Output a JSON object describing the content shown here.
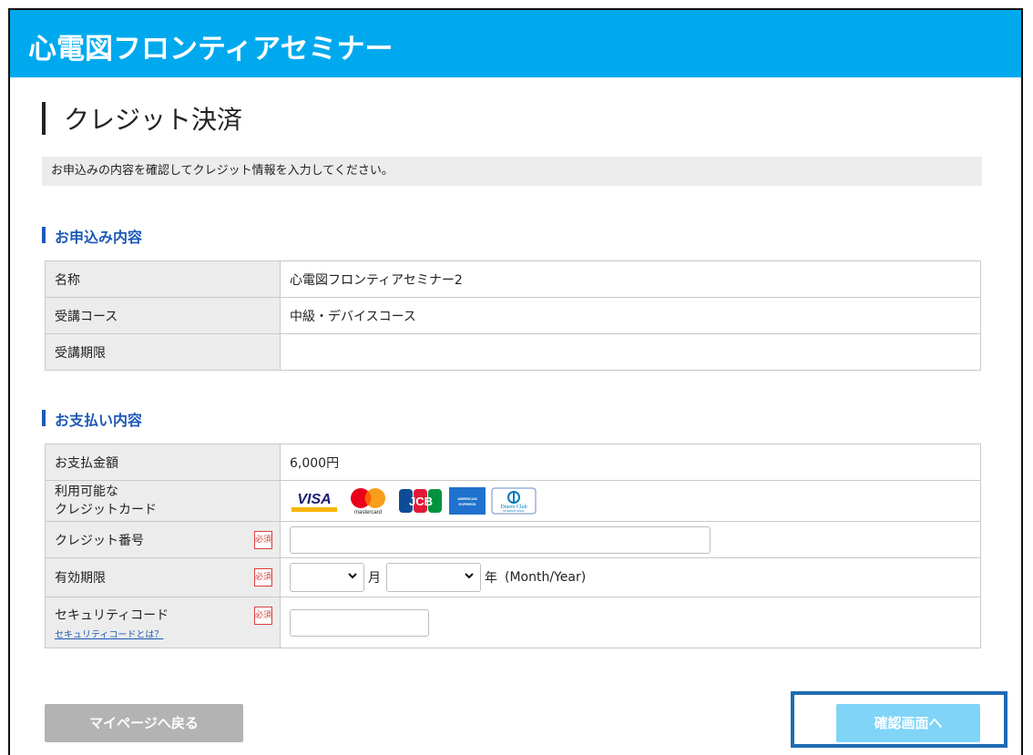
{
  "header": {
    "site_title": "心電図フロンティアセミナー"
  },
  "page": {
    "title": "クレジット決済",
    "instruction": "お申込みの内容を確認してクレジット情報を入力してください。"
  },
  "application": {
    "heading": "お申込み内容",
    "rows": [
      {
        "label": "名称",
        "value": "心電図フロンティアセミナー2"
      },
      {
        "label": "受講コース",
        "value": "中級・デバイスコース"
      },
      {
        "label": "受講期限",
        "value": ""
      }
    ]
  },
  "payment": {
    "heading": "お支払い内容",
    "amount_label": "お支払金額",
    "amount_value": "6,000円",
    "cards_label_line1": "利用可能な",
    "cards_label_line2": "クレジットカード",
    "cards": {
      "visa": "VISA",
      "mastercard": "mastercard",
      "jcb": "JCB",
      "amex": "AMERICAN EXPRESS",
      "diners": "Diners Club",
      "diners_sub": "INTERNATIONAL"
    },
    "card_number_label": "クレジット番号",
    "card_number_value": "",
    "expiry_label": "有効期限",
    "expiry_month_value": "",
    "expiry_month_unit": "月",
    "expiry_year_value": "",
    "expiry_year_unit": "年",
    "expiry_hint": "(Month/Year)",
    "security_label": "セキュリティコード",
    "security_link": "セキュリティコードとは？",
    "security_value": "",
    "required_badge": "必須"
  },
  "actions": {
    "back_label": "マイページへ戻る",
    "confirm_label": "確認画面へ"
  },
  "colors": {
    "header_bg": "#00a9ee",
    "accent": "#1d59b7",
    "required": "#d63f3f",
    "confirm_button": "#7fd4f7",
    "back_button": "#b3b3b3",
    "highlight_box": "#1d6bb3"
  }
}
